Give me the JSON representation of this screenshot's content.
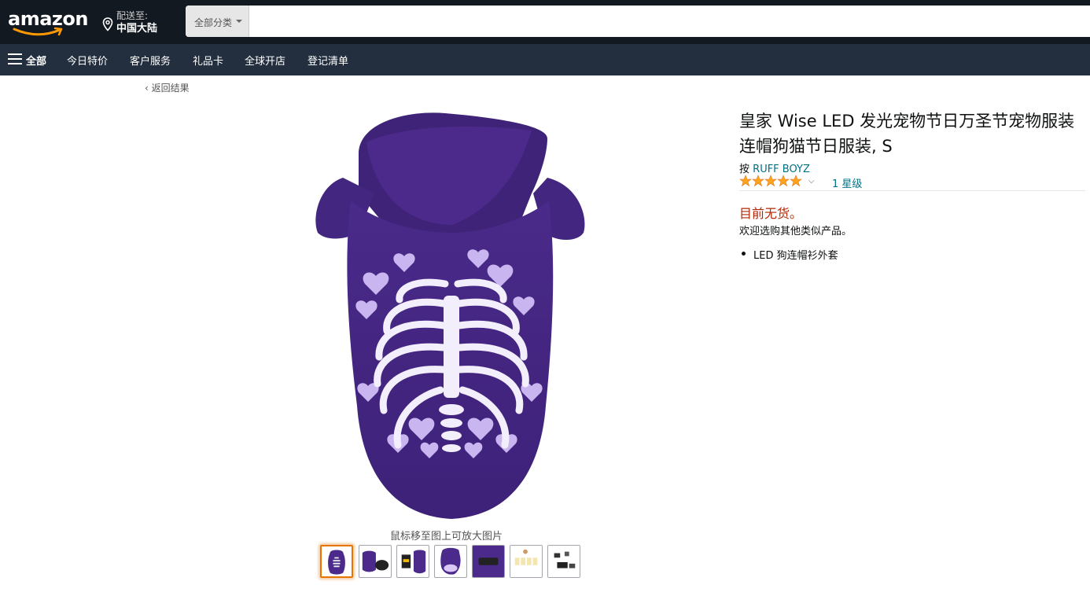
{
  "header": {
    "logo_text": "amazon",
    "deliver_line1": "配送至:",
    "deliver_line2": "中国大陆",
    "search_category": "全部分类",
    "search_value": ""
  },
  "nav": {
    "all_label": "全部",
    "items": [
      "今日特价",
      "客户服务",
      "礼品卡",
      "全球开店",
      "登记清单"
    ]
  },
  "back_link": "‹ 返回结果",
  "product": {
    "title": "皇家 Wise LED 发光宠物节日万圣节宠物服装连帽狗猫节日服装, S",
    "by_prefix": "按",
    "brand": "RUFF BOYZ",
    "rating_stars": 5,
    "rating_count": "1 星级",
    "availability": "目前无货。",
    "availability_sub": "欢迎选购其他类似产品。",
    "bullets": [
      "LED 狗连帽衫外套"
    ],
    "zoom_hint": "鼠标移至图上可放大图片",
    "thumbnail_count": 7
  },
  "colors": {
    "header_bg": "#131921",
    "nav_bg": "#232f3e",
    "link": "#007185",
    "price_red": "#b12704",
    "star": "#ffa41c",
    "hoodie": "#4b2a8c"
  }
}
